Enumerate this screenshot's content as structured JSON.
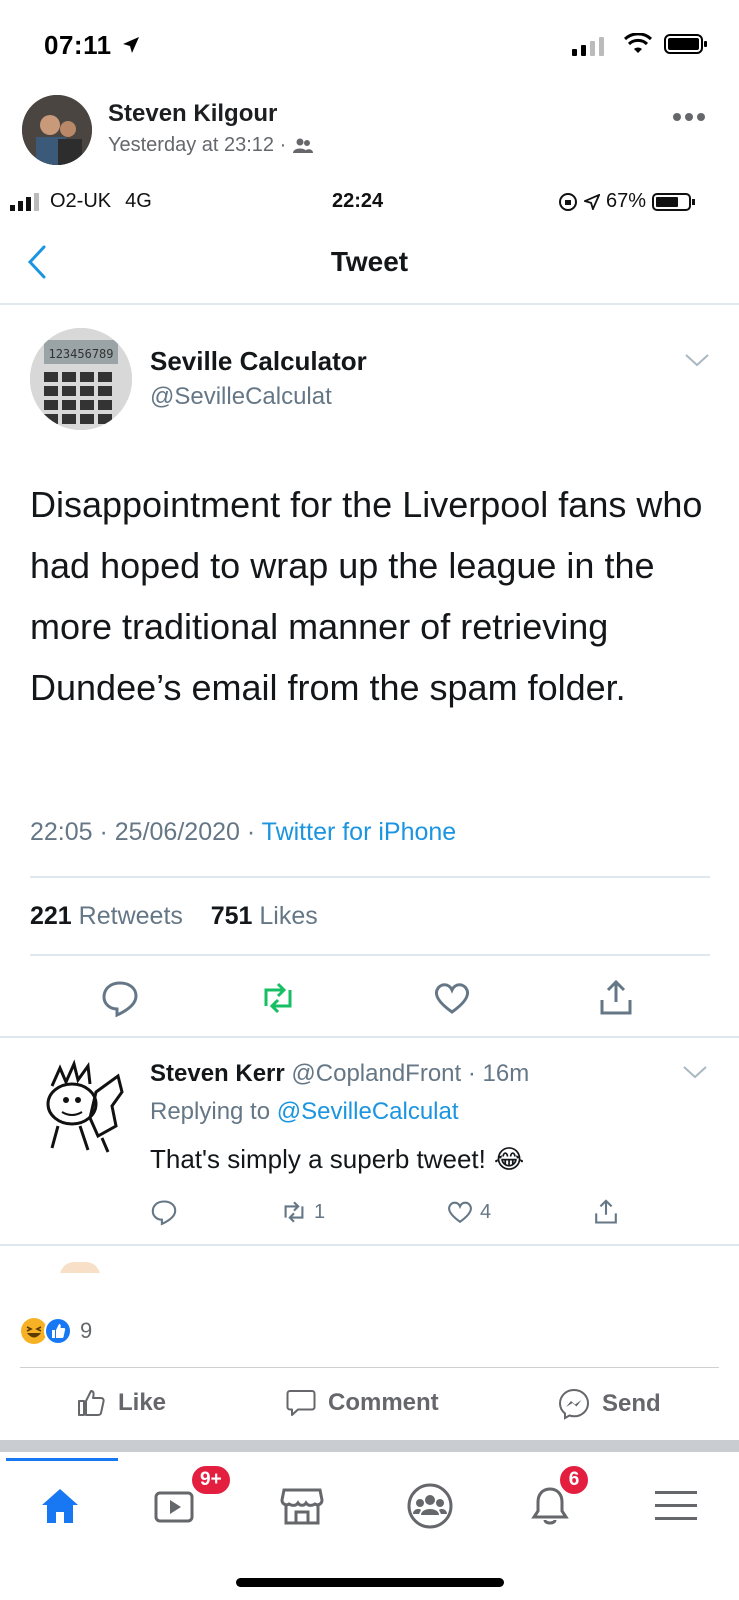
{
  "ios_status": {
    "time": "07:11"
  },
  "post": {
    "author": "Steven Kilgour",
    "timestamp": "Yesterday at 23:12 ·",
    "privacy_icon": "friends-icon",
    "more_icon": "more-dots-icon"
  },
  "shot_status": {
    "carrier": "O2-UK",
    "network": "4G",
    "time": "22:24",
    "battery": "67%"
  },
  "tweet_header": {
    "title": "Tweet"
  },
  "tweet": {
    "name": "Seville Calculator",
    "handle": "@SevilleCalculat",
    "calculator_display": "123456789",
    "text": "Disappointment for the Liverpool fans who had hoped to wrap up the league in the more traditional manner of retrieving Dundee’s email from the spam folder.",
    "time": "22:05 · 25/06/2020 ·",
    "source": "Twitter for iPhone",
    "retweets": "221",
    "retweets_label": "Retweets",
    "likes": "751",
    "likes_label": "Likes"
  },
  "reply": {
    "name": "Steven Kerr",
    "handle": "@CoplandFront",
    "age": "· 16m",
    "replying_label": "Replying to",
    "replying_to": "@SevilleCalculat",
    "text": "That's simply a superb tweet!",
    "emoji": "😂",
    "retweet_count": "1",
    "like_count": "4"
  },
  "reactions": {
    "count": "9"
  },
  "actions": {
    "like": "Like",
    "comment": "Comment",
    "send": "Send"
  },
  "nav": {
    "watch_badge": "9+",
    "notifications_badge": "6"
  },
  "colors": {
    "fb_blue": "#1877f2",
    "twitter_blue": "#1b95e0",
    "retweet_green": "#17bf63",
    "badge_red": "#e41e3f"
  }
}
